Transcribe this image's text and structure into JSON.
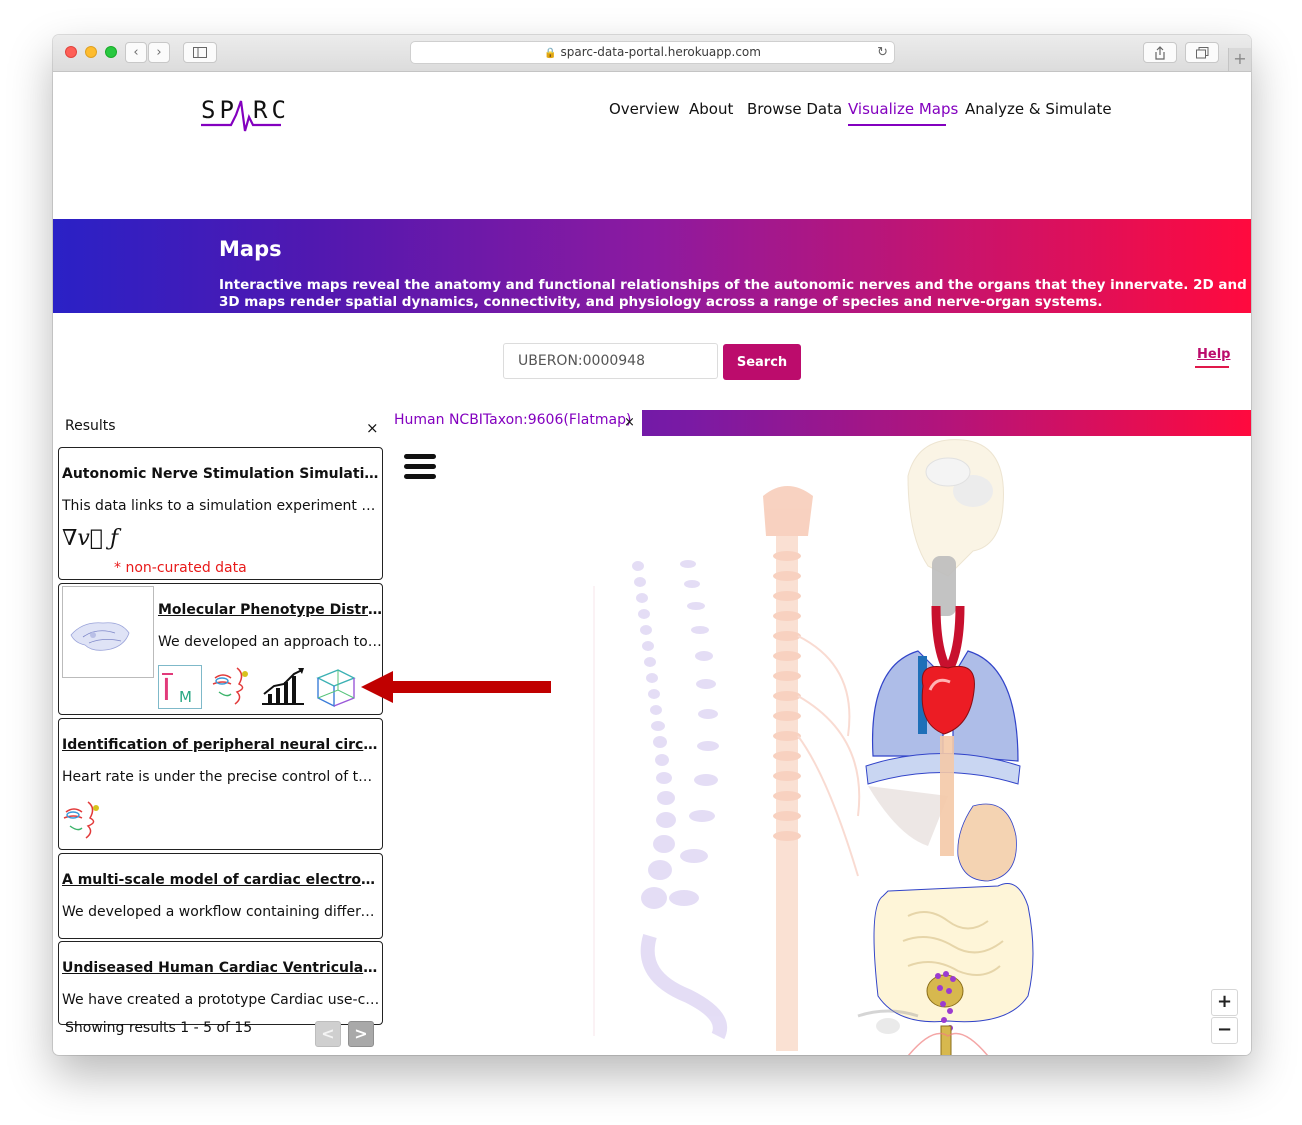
{
  "browser": {
    "url": "sparc-data-portal.herokuapp.com"
  },
  "site": {
    "logo_text": "SPARC",
    "nav": [
      {
        "label": "Overview"
      },
      {
        "label": "About"
      },
      {
        "label": "Browse Data"
      },
      {
        "label": "Visualize Maps",
        "active": true
      },
      {
        "label": "Analyze & Simulate"
      }
    ]
  },
  "hero": {
    "title": "Maps",
    "description": "Interactive maps reveal the anatomy and functional relationships of the autonomic nerves and the organs that they innervate. 2D and 3D maps render spatial dynamics, connectivity, and physiology across a range of species and nerve-organ systems."
  },
  "search": {
    "value": "UBERON:0000948",
    "button_label": "Search",
    "help_label": "Help"
  },
  "results": {
    "title": "Results",
    "close": "×",
    "items": [
      {
        "title": "Autonomic Nerve Stimulation Simulation",
        "description": "This data links to a simulation experiment of th...",
        "note": "* non-curated data",
        "icon_text": "∇v⃗ ƒ"
      },
      {
        "title": "Molecular Phenotype Distributio...",
        "description": "We developed an approach to a..."
      },
      {
        "title": "Identification of peripheral neural circuits that ...",
        "description": "Heart rate is under the precise control of the a..."
      },
      {
        "title": "A multi-scale model of cardiac electrophysiolo...",
        "description": "We developed a workflow containing differenti..."
      },
      {
        "title": "Undiseased Human Cardiac Ventricular Cells",
        "description": "We have created a prototype Cardiac use-case ..."
      }
    ],
    "showing": "Showing results 1 - 5 of 15",
    "prev": "<",
    "next": ">"
  },
  "map": {
    "tab_label": "Human NCBITaxon:9606(Flatmap)",
    "tab_close": "×",
    "zoom_in": "+",
    "zoom_out": "−"
  },
  "colors": {
    "accent_purple": "#8300bf",
    "brand_magenta": "#bc0c6c",
    "warning_red": "#e81a1a",
    "arrow_red": "#c00000"
  }
}
